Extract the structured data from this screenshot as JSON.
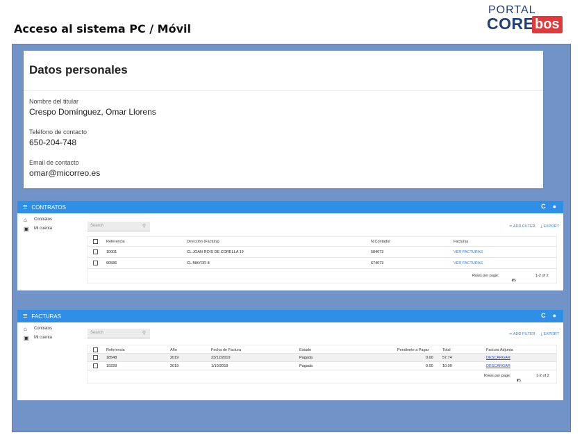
{
  "doc_title": "Acceso al sistema PC / Móvil",
  "logo": {
    "line1": "PORTAL",
    "line2": "CORE",
    "line3": "bos"
  },
  "personal": {
    "title": "Datos personales",
    "fields": [
      {
        "label": "Nombre del titular",
        "value": "Crespo Domínguez, Omar Llorens"
      },
      {
        "label": "Teléfono de contacto",
        "value": "650-204-748"
      },
      {
        "label": "Email de contacto",
        "value": "omar@micorreo.es"
      }
    ]
  },
  "contratos": {
    "title": "CONTRATOS",
    "nav": [
      "Contratos",
      "Mi cuenta"
    ],
    "search_placeholder": "Search",
    "add_filter": "ADD FILTER",
    "export": "EXPORT",
    "columns": [
      "Referencia",
      "Dirección (Factura)",
      "N.Contador",
      "Facturas"
    ],
    "rows": [
      [
        "10001",
        "CL JOAN ROIS DE CORELLA 19",
        "584673",
        "VER FACTURAS"
      ],
      [
        "90586",
        "CL MAYOR 8",
        "674073",
        "VER FACTURAS"
      ]
    ],
    "rows_per_page_label": "Rows per page:",
    "rows_per_page": "25",
    "range": "1-2 of 2"
  },
  "facturas": {
    "title": "FACTURAS",
    "nav": [
      "Contratos",
      "Mi cuenta"
    ],
    "search_placeholder": "Search",
    "add_filter": "ADD FILTER",
    "export": "EXPORT",
    "columns": [
      "Referencia",
      "Año",
      "Fecha de Factura",
      "Estado",
      "Pendiente a Pagar",
      "Total",
      "Factura Adjunta"
    ],
    "rows": [
      [
        "18548",
        "2019",
        "23/12/2019",
        "Pagada",
        "0.00",
        "57.74",
        "DESCARGAR"
      ],
      [
        "19228",
        "2019",
        "1/10/2019",
        "Pagada",
        "0.00",
        "10.00",
        "DESCARGAR"
      ]
    ],
    "rows_per_page_label": "Rows per page:",
    "rows_per_page": "25",
    "range": "1-2 of 2"
  },
  "icons": {
    "menu": "menu-icon",
    "refresh": "refresh-icon",
    "account": "account-circle-icon",
    "bank": "bank-icon",
    "person": "person-icon",
    "search": "search-icon",
    "filter": "filter-icon",
    "download": "download-icon",
    "dropdown": "chevron-down-icon"
  },
  "colors": {
    "appbar": "#2f8ee6",
    "frame": "#7193c8",
    "link": "#2f7fd6"
  }
}
